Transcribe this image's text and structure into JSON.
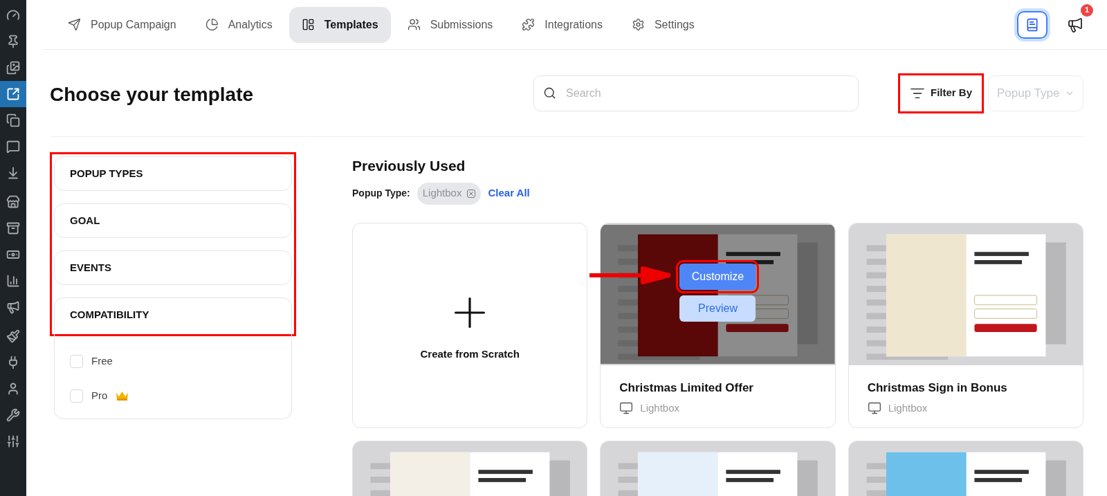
{
  "sidebar": {
    "items": [
      {
        "kind": "dashboard",
        "selected": false
      },
      {
        "kind": "pin",
        "selected": false
      },
      {
        "kind": "media",
        "selected": false
      },
      {
        "kind": "popup",
        "selected": true
      },
      {
        "kind": "pages",
        "selected": false
      },
      {
        "kind": "comments",
        "selected": false
      },
      {
        "kind": "download",
        "selected": false
      },
      {
        "kind": "store",
        "selected": false
      },
      {
        "kind": "archive",
        "selected": false
      },
      {
        "kind": "money",
        "selected": false
      },
      {
        "kind": "chart",
        "selected": false
      },
      {
        "kind": "megaphone",
        "selected": false
      },
      {
        "kind": "brush",
        "selected": false
      },
      {
        "kind": "plugin",
        "selected": false
      },
      {
        "kind": "user",
        "selected": false
      },
      {
        "kind": "wrench",
        "selected": false
      },
      {
        "kind": "sliders",
        "selected": false
      }
    ]
  },
  "tabs": [
    {
      "kind": "campaign",
      "label": "Popup Campaign",
      "selected": false
    },
    {
      "kind": "analytics",
      "label": "Analytics",
      "selected": false
    },
    {
      "kind": "templates",
      "label": "Templates",
      "selected": true
    },
    {
      "kind": "submissions",
      "label": "Submissions",
      "selected": false
    },
    {
      "kind": "integrations",
      "label": "Integrations",
      "selected": false
    },
    {
      "kind": "settings",
      "label": "Settings",
      "selected": false
    }
  ],
  "header_actions": {
    "docs_selected": true,
    "notification_count": "1"
  },
  "title": "Choose your template",
  "search": {
    "placeholder": "Search"
  },
  "filter_by": {
    "label": "Filter By",
    "highlighted": true
  },
  "popup_type_select": {
    "placeholder": "Popup Type"
  },
  "filters": {
    "highlighted": true,
    "sections": [
      {
        "title": "POPUP TYPES",
        "expanded": false
      },
      {
        "title": "GOAL",
        "expanded": false
      },
      {
        "title": "EVENTS",
        "expanded": false
      },
      {
        "title": "COMPATIBILITY",
        "expanded": true,
        "options": [
          {
            "label": "Free",
            "checked": false,
            "kind": "plain"
          },
          {
            "label": "Pro",
            "checked": false,
            "kind": "premium"
          }
        ]
      }
    ]
  },
  "section": {
    "title": "Previously Used",
    "filter_label": "Popup Type:",
    "chips": [
      "Lightbox"
    ],
    "clear_all": "Clear All"
  },
  "templates": [
    {
      "kind": "create",
      "title": "Create from Scratch"
    },
    {
      "kind": "template",
      "color": "#a30d0d",
      "title": "Christmas Limited Offer",
      "type": "Lightbox",
      "hovered": true,
      "customize": "Customize",
      "preview": "Preview",
      "highlighted": true
    },
    {
      "kind": "template",
      "color": "#efe6cf",
      "title": "Christmas Sign in Bonus",
      "type": "Lightbox",
      "hovered": false
    },
    {
      "kind": "template",
      "color": "#f3efe6",
      "hovered": false
    },
    {
      "kind": "template",
      "color": "#e6f0fa",
      "hovered": false
    },
    {
      "kind": "template",
      "color": "#6cc0ea",
      "hovered": false
    }
  ]
}
